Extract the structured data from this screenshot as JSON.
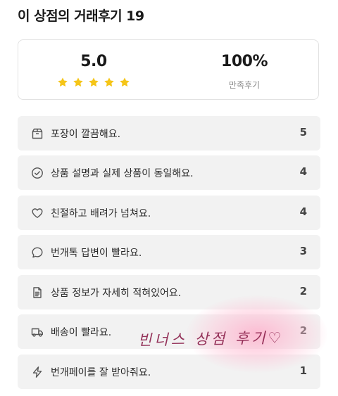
{
  "header": {
    "title": "이 상점의 거래후기 19"
  },
  "summary": {
    "rating": "5.0",
    "rating_stars": 5,
    "star_color": "#f5c518",
    "satisfaction": "100%",
    "satisfaction_label": "만족후기"
  },
  "reviews": [
    {
      "icon": "box-icon",
      "label": "포장이 깔끔해요.",
      "count": "5"
    },
    {
      "icon": "check-circle-icon",
      "label": "상품 설명과 실제 상품이 동일해요.",
      "count": "4"
    },
    {
      "icon": "heart-icon",
      "label": "친절하고 배려가 넘쳐요.",
      "count": "4"
    },
    {
      "icon": "chat-bubble-icon",
      "label": "번개톡 답변이 빨라요.",
      "count": "3"
    },
    {
      "icon": "document-icon",
      "label": "상품 정보가 자세히 적혀있어요.",
      "count": "2"
    },
    {
      "icon": "truck-icon",
      "label": "배송이 빨라요.",
      "count": "2"
    },
    {
      "icon": "lightning-icon",
      "label": "번개페이를 잘 받아줘요.",
      "count": "1"
    }
  ],
  "overlay": {
    "handwriting": "빈너스 상점 후기♡",
    "handwriting_color": "#8a1f4a",
    "glow_color": "#ffb3cc"
  }
}
